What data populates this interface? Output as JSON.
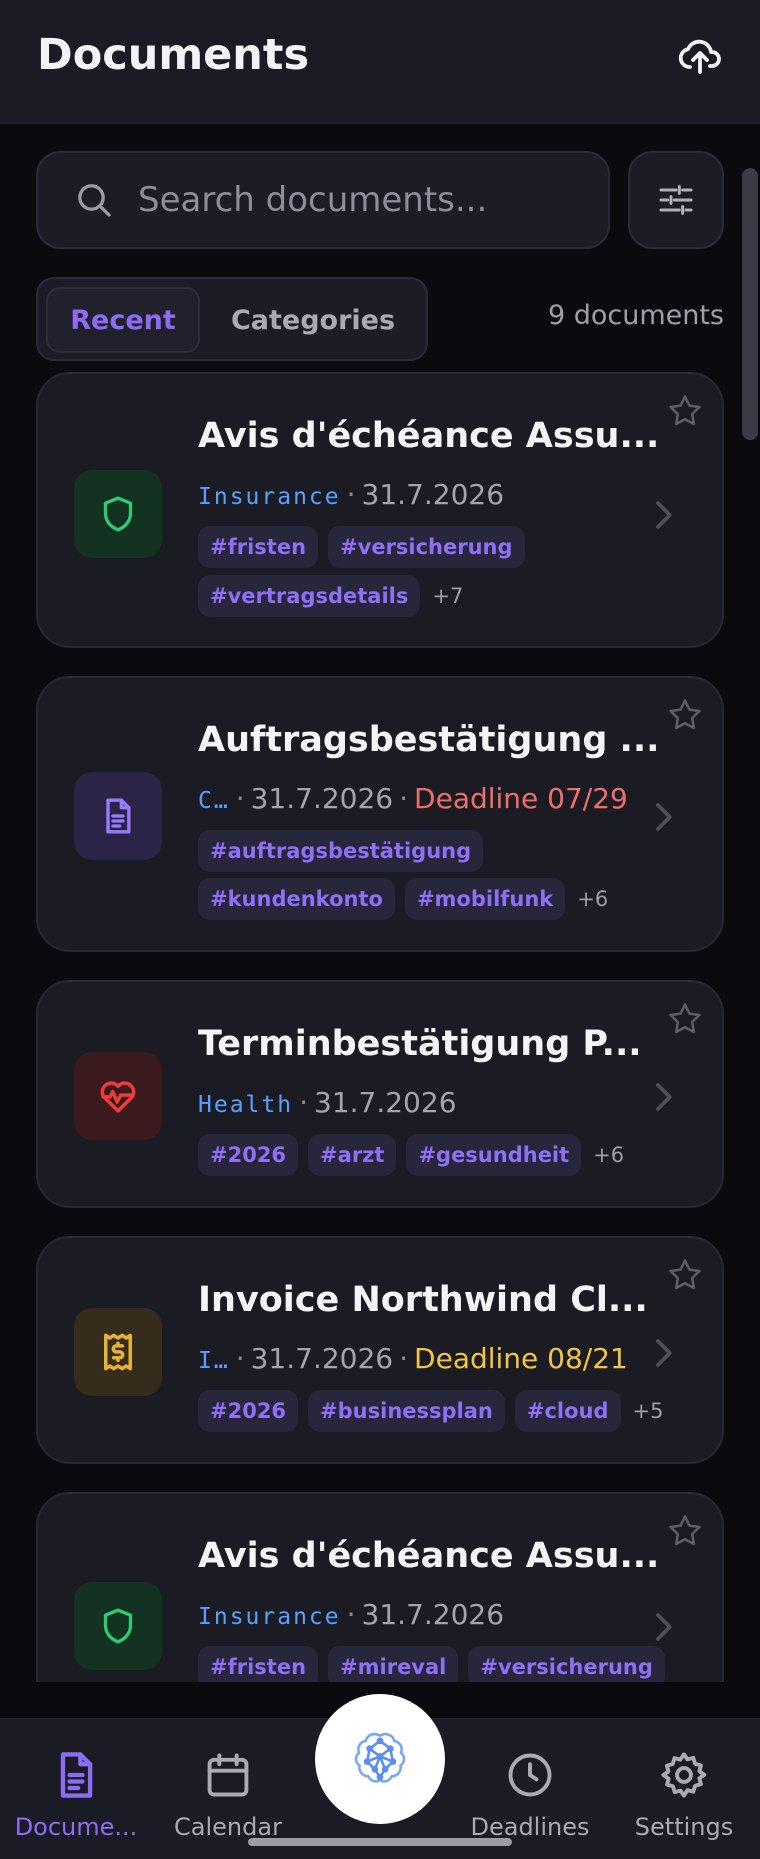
{
  "header": {
    "title": "Documents",
    "upload_icon": "cloud-upload-icon"
  },
  "search": {
    "placeholder": "Search documents...",
    "value": ""
  },
  "tabs": [
    {
      "label": "Recent",
      "active": true
    },
    {
      "label": "Categories",
      "active": false
    }
  ],
  "doc_count": "9 documents",
  "colors": {
    "accent": "#8b6cf2",
    "background": "#0b0b0f",
    "card": "#1a1b23",
    "category_blue": "#5aa0ff",
    "deadline_red": "#ef6d6d",
    "deadline_yellow": "#f4c542"
  },
  "documents": [
    {
      "title": "Avis d'échéance Assu...",
      "icon": "shield-icon",
      "category": "Insurance",
      "date": "31.7.2026",
      "deadline": "",
      "tags_row1": [
        "#fristen",
        "#versicherung"
      ],
      "tags_row2": [
        "#vertragsdetails"
      ],
      "more": "+7"
    },
    {
      "title": "Auftragsbestätigung ...",
      "icon": "document-icon",
      "category": "C…",
      "date": "31.7.2026",
      "deadline": "Deadline 07/29",
      "tags_row1": [
        "#auftragsbestätigung"
      ],
      "tags_row2": [
        "#kundenkonto",
        "#mobilfunk"
      ],
      "more": "+6"
    },
    {
      "title": "Terminbestätigung P...",
      "icon": "heart-pulse-icon",
      "category": "Health",
      "date": "31.7.2026",
      "deadline": "",
      "tags_row1": [
        "#2026",
        "#arzt",
        "#gesundheit"
      ],
      "tags_row2": [],
      "more": "+6"
    },
    {
      "title": "Invoice Northwind Cl...",
      "icon": "receipt-icon",
      "category": "I…",
      "date": "31.7.2026",
      "deadline": "Deadline 08/21",
      "tags_row1": [
        "#2026",
        "#businessplan",
        "#cloud"
      ],
      "tags_row2": [],
      "more": "+5"
    },
    {
      "title": "Avis d'échéance Assu...",
      "icon": "shield-icon",
      "category": "Insurance",
      "date": "31.7.2026",
      "deadline": "",
      "tags_row1": [
        "#fristen",
        "#mireval",
        "#versicherung"
      ],
      "tags_row2": [],
      "more": ""
    }
  ],
  "nav": [
    {
      "label": "Docume...",
      "icon": "document-icon",
      "active": true
    },
    {
      "label": "Calendar",
      "icon": "calendar-icon",
      "active": false
    },
    {
      "label": "",
      "icon": "brain-network-icon",
      "active": false
    },
    {
      "label": "Deadlines",
      "icon": "clock-icon",
      "active": false
    },
    {
      "label": "Settings",
      "icon": "gear-icon",
      "active": false
    }
  ]
}
